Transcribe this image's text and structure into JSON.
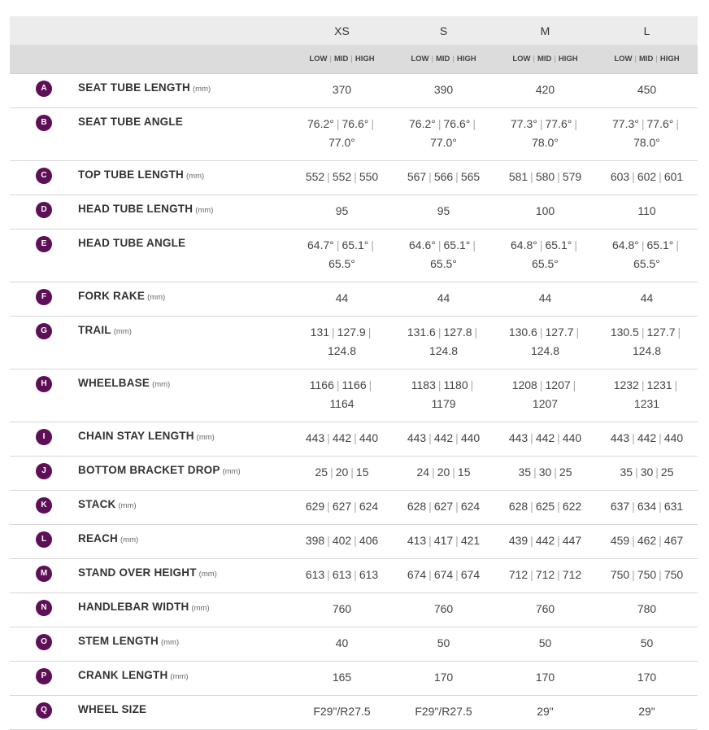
{
  "sizes": [
    "XS",
    "S",
    "M",
    "L"
  ],
  "level_labels": [
    "LOW",
    "MID",
    "HIGH"
  ],
  "colors": {
    "badge": "#5e0f58",
    "header_light": "#ececec",
    "header_dark": "#dcdcdc"
  },
  "rows": [
    {
      "letter": "A",
      "label": "SEAT TUBE LENGTH",
      "unit": "(mm)",
      "values": [
        [
          "370"
        ],
        [
          "390"
        ],
        [
          "420"
        ],
        [
          "450"
        ]
      ]
    },
    {
      "letter": "B",
      "label": "SEAT TUBE ANGLE",
      "unit": "",
      "values": [
        [
          "76.2°",
          "76.6°",
          "77.0°"
        ],
        [
          "76.2°",
          "76.6°",
          "77.0°"
        ],
        [
          "77.3°",
          "77.6°",
          "78.0°"
        ],
        [
          "77.3°",
          "77.6°",
          "78.0°"
        ]
      ]
    },
    {
      "letter": "C",
      "label": "TOP TUBE LENGTH",
      "unit": "(mm)",
      "values": [
        [
          "552",
          "552",
          "550"
        ],
        [
          "567",
          "566",
          "565"
        ],
        [
          "581",
          "580",
          "579"
        ],
        [
          "603",
          "602",
          "601"
        ]
      ]
    },
    {
      "letter": "D",
      "label": "HEAD TUBE LENGTH",
      "unit": "(mm)",
      "values": [
        [
          "95"
        ],
        [
          "95"
        ],
        [
          "100"
        ],
        [
          "110"
        ]
      ]
    },
    {
      "letter": "E",
      "label": "HEAD TUBE ANGLE",
      "unit": "",
      "values": [
        [
          "64.7°",
          "65.1°",
          "65.5°"
        ],
        [
          "64.6°",
          "65.1°",
          "65.5°"
        ],
        [
          "64.8°",
          "65.1°",
          "65.5°"
        ],
        [
          "64.8°",
          "65.1°",
          "65.5°"
        ]
      ]
    },
    {
      "letter": "F",
      "label": "FORK RAKE",
      "unit": "(mm)",
      "values": [
        [
          "44"
        ],
        [
          "44"
        ],
        [
          "44"
        ],
        [
          "44"
        ]
      ]
    },
    {
      "letter": "G",
      "label": "TRAIL",
      "unit": "(mm)",
      "values": [
        [
          "131",
          "127.9",
          "124.8"
        ],
        [
          "131.6",
          "127.8",
          "124.8"
        ],
        [
          "130.6",
          "127.7",
          "124.8"
        ],
        [
          "130.5",
          "127.7",
          "124.8"
        ]
      ]
    },
    {
      "letter": "H",
      "label": "WHEELBASE",
      "unit": "(mm)",
      "values": [
        [
          "1166",
          "1166",
          "1164"
        ],
        [
          "1183",
          "1180",
          "1179"
        ],
        [
          "1208",
          "1207",
          "1207"
        ],
        [
          "1232",
          "1231",
          "1231"
        ]
      ]
    },
    {
      "letter": "I",
      "label": "CHAIN STAY LENGTH",
      "unit": "(mm)",
      "values": [
        [
          "443",
          "442",
          "440"
        ],
        [
          "443",
          "442",
          "440"
        ],
        [
          "443",
          "442",
          "440"
        ],
        [
          "443",
          "442",
          "440"
        ]
      ]
    },
    {
      "letter": "J",
      "label": "BOTTOM BRACKET DROP",
      "unit": "(mm)",
      "values": [
        [
          "25",
          "20",
          "15"
        ],
        [
          "24",
          "20",
          "15"
        ],
        [
          "35",
          "30",
          "25"
        ],
        [
          "35",
          "30",
          "25"
        ]
      ]
    },
    {
      "letter": "K",
      "label": "STACK",
      "unit": "(mm)",
      "values": [
        [
          "629",
          "627",
          "624"
        ],
        [
          "628",
          "627",
          "624"
        ],
        [
          "628",
          "625",
          "622"
        ],
        [
          "637",
          "634",
          "631"
        ]
      ]
    },
    {
      "letter": "L",
      "label": "REACH",
      "unit": "(mm)",
      "values": [
        [
          "398",
          "402",
          "406"
        ],
        [
          "413",
          "417",
          "421"
        ],
        [
          "439",
          "442",
          "447"
        ],
        [
          "459",
          "462",
          "467"
        ]
      ]
    },
    {
      "letter": "M",
      "label": "STAND OVER HEIGHT",
      "unit": "(mm)",
      "values": [
        [
          "613",
          "613",
          "613"
        ],
        [
          "674",
          "674",
          "674"
        ],
        [
          "712",
          "712",
          "712"
        ],
        [
          "750",
          "750",
          "750"
        ]
      ]
    },
    {
      "letter": "N",
      "label": "HANDLEBAR WIDTH",
      "unit": "(mm)",
      "values": [
        [
          "760"
        ],
        [
          "760"
        ],
        [
          "760"
        ],
        [
          "780"
        ]
      ]
    },
    {
      "letter": "O",
      "label": "STEM LENGTH",
      "unit": "(mm)",
      "values": [
        [
          "40"
        ],
        [
          "50"
        ],
        [
          "50"
        ],
        [
          "50"
        ]
      ]
    },
    {
      "letter": "P",
      "label": "CRANK LENGTH",
      "unit": "(mm)",
      "values": [
        [
          "165"
        ],
        [
          "170"
        ],
        [
          "170"
        ],
        [
          "170"
        ]
      ]
    },
    {
      "letter": "Q",
      "label": "WHEEL SIZE",
      "unit": "",
      "values": [
        [
          "F29\"/R27.5"
        ],
        [
          "F29\"/R27.5"
        ],
        [
          "29\""
        ],
        [
          "29\""
        ]
      ]
    }
  ]
}
